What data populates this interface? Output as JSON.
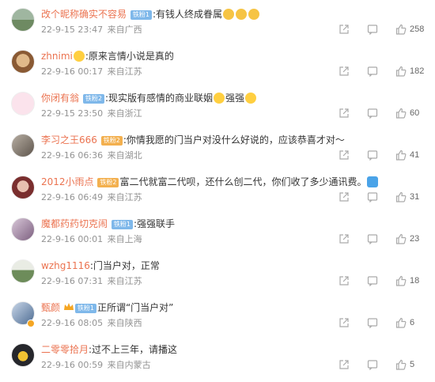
{
  "comments": [
    {
      "username": "改个昵称确实不容易",
      "badge": "铁粉1",
      "badge_color": "#7fb8ea",
      "text": ":有钱人终成眷属",
      "emojis": [
        "clap",
        "clap",
        "clap"
      ],
      "time": "22-9-15 23:47",
      "location": "来自广西",
      "likes": "258",
      "avatar_color": "#8fa88a",
      "crown": false
    },
    {
      "username": "zhnimi",
      "badge": "",
      "text": ":原来言情小说是真的",
      "emoji_before": true,
      "emojis": [],
      "time": "22-9-16 00:17",
      "location": "来自江苏",
      "likes": "182",
      "avatar_color": "#b98a5c",
      "crown": false
    },
    {
      "username": "你闭有翁",
      "badge": "铁粉2",
      "badge_color": "#7fb8ea",
      "text": ":现实版有感情的商业联姻",
      "emojis_mid": true,
      "text2": "强强",
      "emojis": [
        "grin"
      ],
      "time": "22-9-15 23:50",
      "location": "来自浙江",
      "likes": "60",
      "avatar_color": "#f4c7d6",
      "crown": false
    },
    {
      "username": "李习之王666",
      "badge": "铁粉2",
      "badge_color": "#f3b04f",
      "text": ":你情我愿的门当户对没什么好说的，应该恭喜才对～",
      "emojis": [],
      "time": "22-9-16 06:36",
      "location": "来自湖北",
      "likes": "41",
      "avatar_color": "#7f7468",
      "crown": false
    },
    {
      "username": "2012小雨点",
      "badge": "铁粉2",
      "badge_color": "#f3b04f",
      "text": "富二代就富二代呗，还什么创二代，你们收了多少通讯费。",
      "emojis": [
        "blue"
      ],
      "time": "22-9-16 06:49",
      "location": "来自江苏",
      "likes": "31",
      "avatar_color": "#c25a5a",
      "crown": false
    },
    {
      "username": "魔都药药切克闹",
      "badge": "铁粉1",
      "badge_color": "#7fb8ea",
      "text": ":强强联手",
      "emojis": [],
      "time": "22-9-16 00:01",
      "location": "来自上海",
      "likes": "23",
      "avatar_color": "#a98ca8",
      "crown": false
    },
    {
      "username": "wzhg1116",
      "badge": "",
      "text": ":门当户对，正常",
      "emojis": [],
      "time": "22-9-16 07:31",
      "location": "来自江苏",
      "likes": "18",
      "avatar_color": "#6d8c5a",
      "crown": false
    },
    {
      "username": "甄颜",
      "badge": "铁粉1",
      "badge_color": "#7fb8ea",
      "text": "正所谓“门当户对”",
      "emojis": [],
      "time": "22-9-16 08:05",
      "location": "来自陕西",
      "likes": "6",
      "avatar_color": "#5a7aa0",
      "crown": true
    },
    {
      "username": "二零零拾月",
      "badge": "",
      "text": ":过不上三年，请播这",
      "emojis": [],
      "time": "22-9-16 00:59",
      "location": "来自内蒙古",
      "likes": "5",
      "avatar_color": "#2f3036",
      "crown": false
    }
  ],
  "icons": {
    "share": "share-icon",
    "comment": "comment-icon",
    "like": "like-icon"
  },
  "colors": {
    "username": "#eb7350",
    "meta": "#939393",
    "text": "#333333"
  }
}
